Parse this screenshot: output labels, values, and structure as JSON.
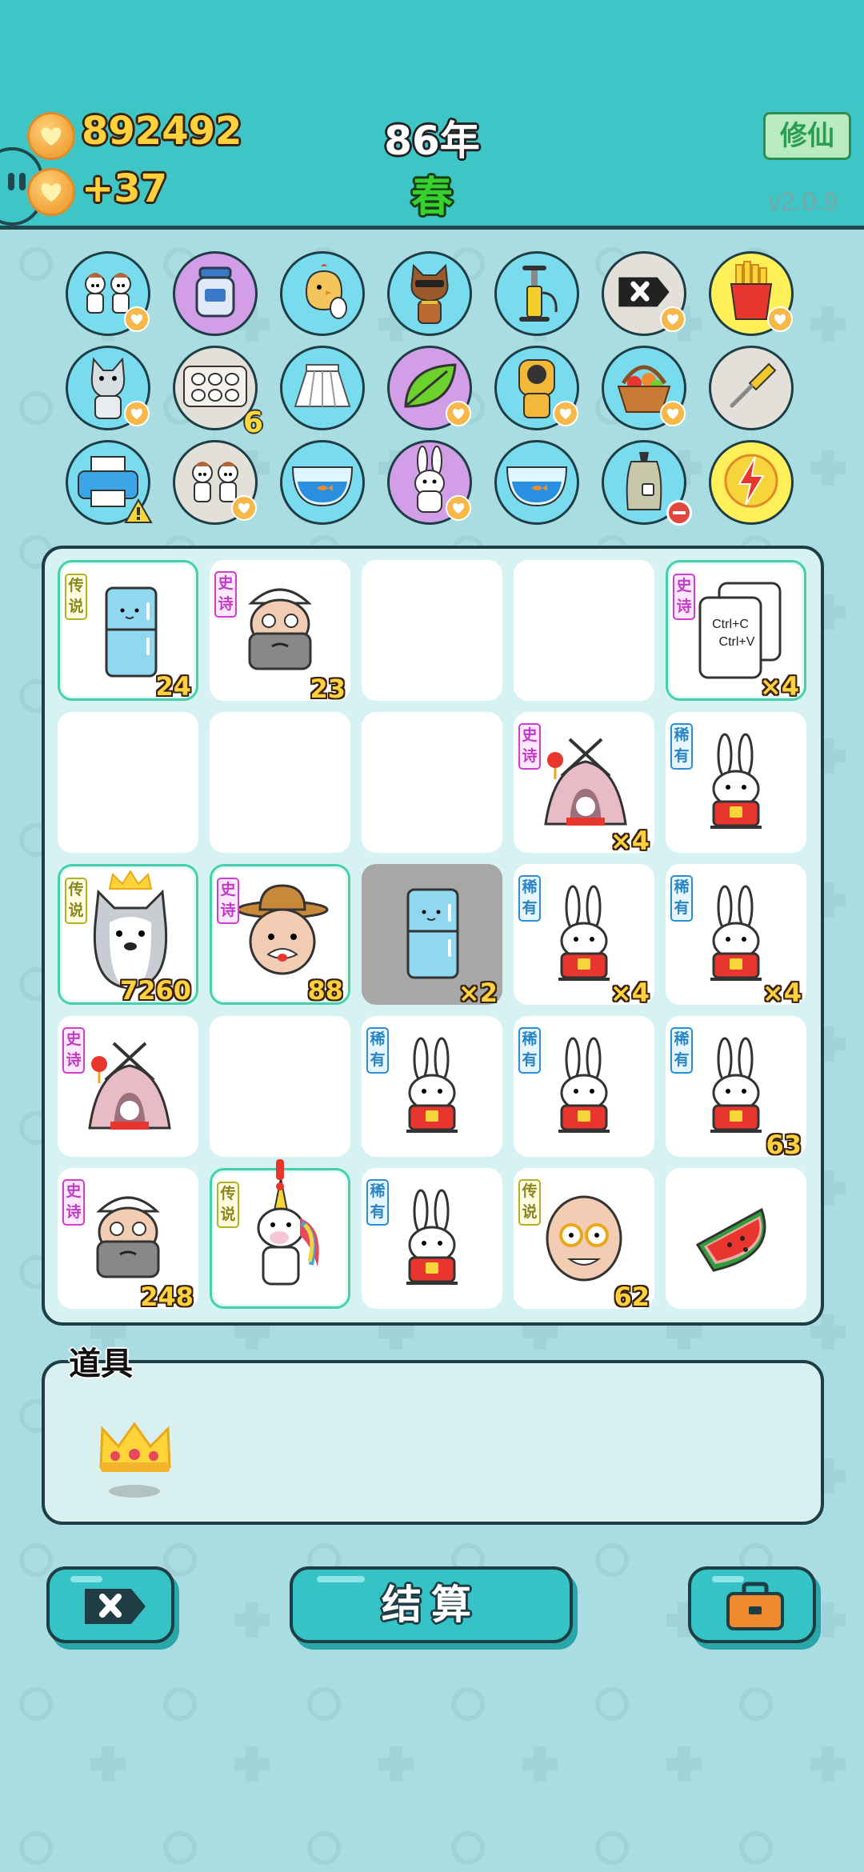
{
  "header": {
    "coins": "892492",
    "income": "+37",
    "year": "86年",
    "season": "春",
    "mode_button": "修仙",
    "version": "v2.0.9"
  },
  "items_row": [
    {
      "icon": "cow-maids-icon",
      "color": "blue",
      "heart": true
    },
    {
      "icon": "jar-icon",
      "color": "purple",
      "heart": false
    },
    {
      "icon": "chick-egg-icon",
      "color": "blue",
      "heart": false
    },
    {
      "icon": "cool-cat-icon",
      "color": "blue",
      "heart": false
    },
    {
      "icon": "air-pump-icon",
      "color": "blue",
      "heart": false
    },
    {
      "icon": "remove-tag-icon",
      "color": "gray",
      "heart": true
    },
    {
      "icon": "fries-icon",
      "color": "yellow",
      "heart": true
    },
    {
      "icon": "husky-icon",
      "color": "blue",
      "heart": true
    },
    {
      "icon": "egg-tray-icon",
      "color": "gray",
      "heart": false,
      "count": "6"
    },
    {
      "icon": "skirt-icon",
      "color": "blue",
      "heart": false
    },
    {
      "icon": "leaf-icon",
      "color": "purple",
      "heart": true
    },
    {
      "icon": "bear-cat-icon",
      "color": "blue",
      "heart": true
    },
    {
      "icon": "fruit-basket-icon",
      "color": "blue",
      "heart": true
    },
    {
      "icon": "screwdriver-icon",
      "color": "gray",
      "heart": false
    },
    {
      "icon": "printer-icon",
      "color": "blue",
      "heart": false,
      "warning": true
    },
    {
      "icon": "cow-maids-icon",
      "color": "gray",
      "heart": true
    },
    {
      "icon": "fish-bowl-icon",
      "color": "blue",
      "heart": false
    },
    {
      "icon": "bunny-icon",
      "color": "purple",
      "heart": true
    },
    {
      "icon": "fish-bowl-icon",
      "color": "blue",
      "heart": false
    },
    {
      "icon": "trash-bag-icon",
      "color": "blue",
      "heart": false,
      "minus": true
    },
    {
      "icon": "lightning-icon",
      "color": "yellow",
      "heart": false
    }
  ],
  "board": {
    "cells": [
      {
        "item": "fridge",
        "tag": "传说",
        "tagType": "legend",
        "value": "24",
        "highlight": true
      },
      {
        "item": "grandpa",
        "tag": "史诗",
        "tagType": "epic",
        "value": "23"
      },
      {
        "item": ""
      },
      {
        "item": ""
      },
      {
        "item": "copy-paste",
        "tag": "史诗",
        "tagType": "epic",
        "value": "×4",
        "highlight": true
      },
      {
        "item": ""
      },
      {
        "item": ""
      },
      {
        "item": ""
      },
      {
        "item": "bunny-tent",
        "tag": "史诗",
        "tagType": "epic",
        "value": "×4"
      },
      {
        "item": "bunny",
        "tag": "稀有",
        "tagType": "rare",
        "value": ""
      },
      {
        "item": "husky-king",
        "tag": "传说",
        "tagType": "legend",
        "value": "7260",
        "highlight": true
      },
      {
        "item": "farmer",
        "tag": "史诗",
        "tagType": "epic",
        "value": "88",
        "highlight": true
      },
      {
        "item": "fridge",
        "value": "×2",
        "selected": true
      },
      {
        "item": "bunny",
        "tag": "稀有",
        "tagType": "rare",
        "value": "×4"
      },
      {
        "item": "bunny",
        "tag": "稀有",
        "tagType": "rare",
        "value": "×4"
      },
      {
        "item": "bunny-tent",
        "tag": "史诗",
        "tagType": "epic",
        "value": ""
      },
      {
        "item": ""
      },
      {
        "item": "bunny",
        "tag": "稀有",
        "tagType": "rare",
        "value": ""
      },
      {
        "item": "bunny",
        "tag": "稀有",
        "tagType": "rare",
        "value": ""
      },
      {
        "item": "bunny",
        "tag": "稀有",
        "tagType": "rare",
        "value": "63"
      },
      {
        "item": "grandpa",
        "tag": "史诗",
        "tagType": "epic",
        "value": "248"
      },
      {
        "item": "unicorn",
        "tag": "传说",
        "tagType": "legend",
        "value": "",
        "highlight": true,
        "alert": true
      },
      {
        "item": "bunny",
        "tag": "稀有",
        "tagType": "rare",
        "value": ""
      },
      {
        "item": "old-man",
        "tag": "传说",
        "tagType": "legend",
        "value": "62"
      },
      {
        "item": "watermelon",
        "value": ""
      }
    ]
  },
  "props": {
    "title": "道具",
    "items": [
      {
        "icon": "crown-icon"
      }
    ]
  },
  "buttons": {
    "settle": "结算",
    "remove_icon": "remove-tag-icon",
    "bag_icon": "briefcase-icon"
  },
  "colors": {
    "header": "#3ec6c6",
    "background": "#a9dde2",
    "legend": "#b4af24",
    "epic": "#cc3fcf",
    "rare": "#2b8fd4",
    "highlight": "#46d1ad"
  }
}
